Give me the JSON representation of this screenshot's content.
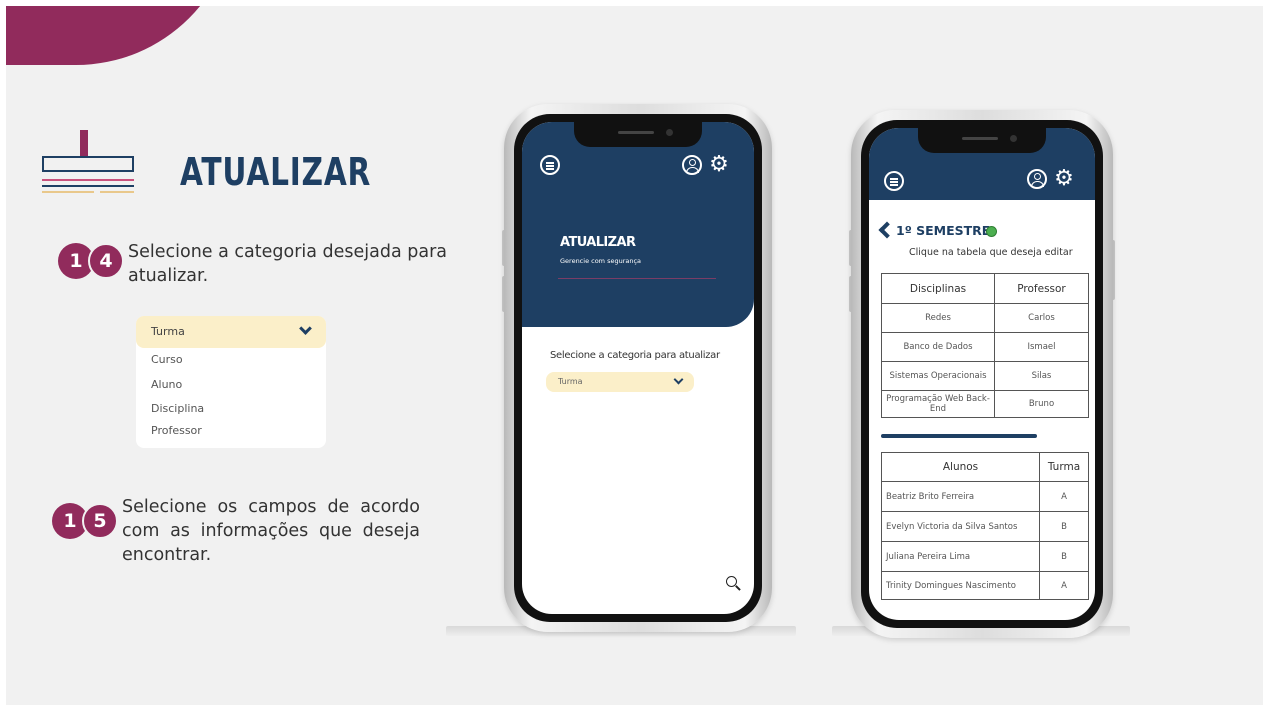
{
  "slide": {
    "title": "ATUALIZAR",
    "brand_color": "#912b5c",
    "navy_color": "#1e3f63"
  },
  "steps": [
    {
      "number_a": "1",
      "number_b": "4",
      "text": "Selecione a categoria desejada para atualizar."
    },
    {
      "number_a": "1",
      "number_b": "5",
      "text": "Selecione os campos de acordo com as informações que deseja encontrar."
    }
  ],
  "dropdown_demo": {
    "selected": "Turma",
    "options": [
      "Curso",
      "Aluno",
      "Disciplina",
      "Professor"
    ]
  },
  "phone1": {
    "header_icons": [
      "menu-icon",
      "user-icon",
      "gear-icon"
    ],
    "title": "ATUALIZAR",
    "subtitle": "Gerencie com segurança",
    "category_label": "Selecione a categoria para atualizar",
    "select_value": "Turma"
  },
  "phone2": {
    "semester_title": "1º SEMESTRE",
    "instruction": "Clique na tabela que deseja editar",
    "disciplines_table": {
      "headers": [
        "Disciplinas",
        "Professor"
      ],
      "rows": [
        [
          "Redes",
          "Carlos"
        ],
        [
          "Banco de Dados",
          "Ismael"
        ],
        [
          "Sistemas Operacionais",
          "Silas"
        ],
        [
          "Programação Web Back-End",
          "Bruno"
        ]
      ]
    },
    "students_table": {
      "headers": [
        "Alunos",
        "Turma"
      ],
      "rows": [
        [
          "Beatriz Brito Ferreira",
          "A"
        ],
        [
          "Evelyn Victoria da Silva Santos",
          "B"
        ],
        [
          "Juliana Pereira Lima",
          "B"
        ],
        [
          "Trinity Domingues Nascimento",
          "A"
        ]
      ]
    }
  }
}
